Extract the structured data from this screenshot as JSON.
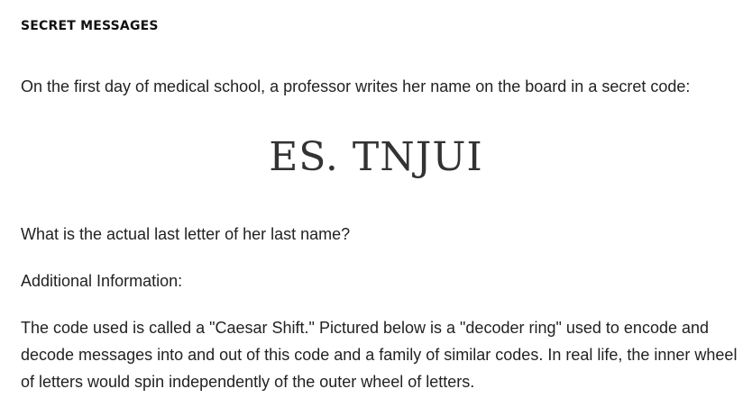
{
  "document": {
    "section_title": "SECRET MESSAGES",
    "intro": "On the first day of medical school, a professor writes her name on the board in a secret code:",
    "code": "ES. TNJUI",
    "question": "What is the actual last letter of her last name?",
    "additional_label": "Additional Information:",
    "explanation": "The code used is called a \"Caesar Shift.\" Pictured below is a \"decoder ring\" used to encode and decode messages into and out of this code and a family of similar codes. In real life, the inner wheel of letters would spin independently of the outer wheel of letters."
  }
}
